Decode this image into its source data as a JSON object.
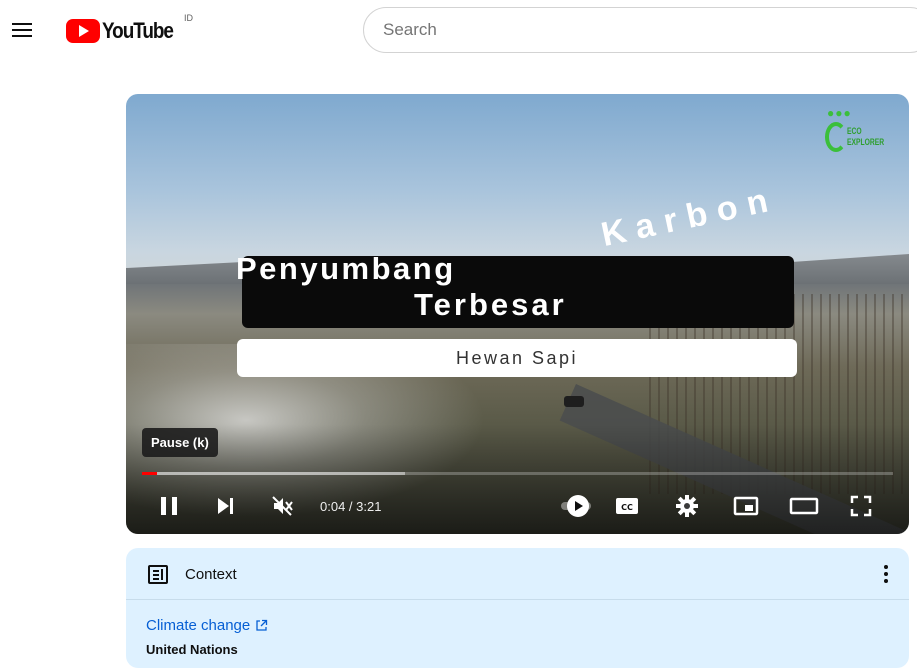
{
  "header": {
    "logo_text": "YouTube",
    "country_code": "ID",
    "search_placeholder": "Search"
  },
  "video": {
    "channel_watermark": [
      "ECO",
      "EXPLORER"
    ],
    "title_line1": "Penyumbang",
    "title_line1_word2": "Karbon",
    "title_line2": "Terbesar",
    "subtitle": "Hewan Sapi",
    "tooltip": "Pause (k)",
    "time_display": "0:04 / 3:21",
    "progress_played_fraction": 0.02,
    "progress_buffered_fraction": 0.35,
    "is_muted": true,
    "is_playing": true
  },
  "context_panel": {
    "title": "Context",
    "link_text": "Climate change",
    "source": "United Nations"
  },
  "icons": {
    "menu": "menu-icon",
    "pause": "pause-icon",
    "next": "next-icon",
    "volume": "volume-muted-icon",
    "autoplay": "autoplay-toggle-icon",
    "captions": "captions-icon",
    "settings": "gear-icon",
    "miniplayer": "miniplayer-icon",
    "theater": "theater-mode-icon",
    "fullscreen": "fullscreen-icon",
    "context": "context-info-icon",
    "more": "more-vert-icon",
    "external": "external-link-icon"
  },
  "colors": {
    "brand_red": "#ff0000",
    "link_blue": "#065fd4",
    "context_bg": "#def1ff",
    "eco_green": "#3bbf3b"
  }
}
